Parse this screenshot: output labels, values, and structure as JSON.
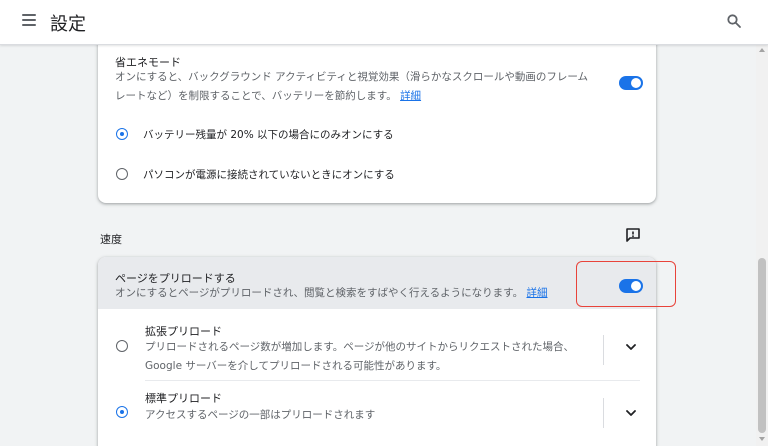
{
  "header": {
    "title": "設定"
  },
  "energy_saver": {
    "title": "省エネモード",
    "description": "オンにすると、バックグラウンド アクティビティと視覚効果（滑らかなスクロールや動画のフレーム",
    "description_line2": "レートなど）を制限することで、バッテリーを節約します。",
    "details_link": "詳細",
    "enabled": true,
    "options": [
      {
        "label": "バッテリー残量が 20% 以下の場合にのみオンにする",
        "selected": true
      },
      {
        "label": "パソコンが電源に接続されていないときにオンにする",
        "selected": false
      }
    ]
  },
  "speed": {
    "section_label": "速度",
    "preload": {
      "title": "ページをプリロードする",
      "description": "オンにするとページがプリロードされ、閲覧と検索をすばやく行えるようになります。",
      "details_link": "詳細",
      "enabled": true
    },
    "options": [
      {
        "title": "拡張プリロード",
        "description_line1": "プリロードされるページ数が増加します。ページが他のサイトからリクエストされた場合、",
        "description_line2": "Google サーバーを介してプリロードされる可能性があります。",
        "selected": false
      },
      {
        "title": "標準プリロード",
        "description_line1": "アクセスするページの一部はプリロードされます",
        "selected": true
      }
    ]
  },
  "colors": {
    "accent": "#1a73e8",
    "highlight_border": "#e8433a"
  },
  "icons": {
    "menu": "hamburger-icon",
    "search": "search-icon",
    "feedback": "feedback-icon",
    "expand": "chevron-down-icon"
  }
}
